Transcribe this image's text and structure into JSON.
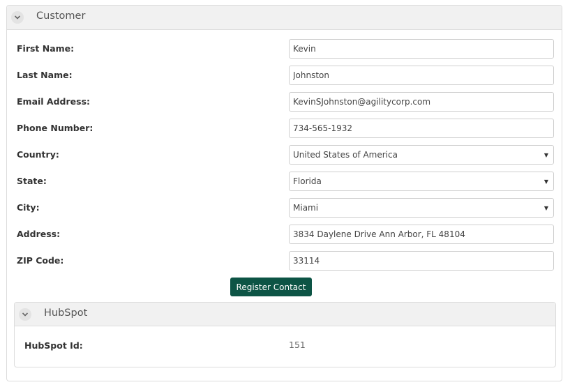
{
  "customer": {
    "title": "Customer",
    "fields": [
      {
        "label": "First Name:",
        "value": "Kevin",
        "type": "text"
      },
      {
        "label": "Last Name:",
        "value": "Johnston",
        "type": "text"
      },
      {
        "label": "Email Address:",
        "value": "KevinSJohnston@agilitycorp.com",
        "type": "text"
      },
      {
        "label": "Phone Number:",
        "value": "734-565-1932",
        "type": "text"
      },
      {
        "label": "Country:",
        "value": "United States of America",
        "type": "select"
      },
      {
        "label": "State:",
        "value": "Florida",
        "type": "select"
      },
      {
        "label": "City:",
        "value": "Miami",
        "type": "select"
      },
      {
        "label": "Address:",
        "value": "3834 Daylene Drive Ann Arbor, FL 48104",
        "type": "text"
      },
      {
        "label": "ZIP Code:",
        "value": "33114",
        "type": "text"
      }
    ],
    "register_button": "Register Contact"
  },
  "hubspot": {
    "title": "HubSpot",
    "id_label": "HubSpot Id:",
    "id_value": "151"
  },
  "icons": {
    "collapse": "chevron-down-icon",
    "select_caret": "caret-down-icon"
  },
  "colors": {
    "button_bg": "#0d5445",
    "header_bg": "#f1f1f1"
  }
}
